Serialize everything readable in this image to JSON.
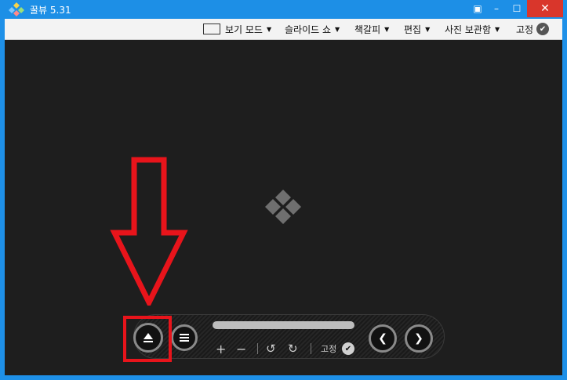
{
  "window": {
    "title": "꿀뷰 5.31",
    "close_glyph": "✕",
    "minimize_glyph": "–",
    "maximize_glyph": "☐",
    "fit_glyph": "▣"
  },
  "menubar": {
    "items": [
      {
        "label": "보기 모드",
        "icon": "view-mode-icon"
      },
      {
        "label": "슬라이드 쇼"
      },
      {
        "label": "책갈피"
      },
      {
        "label": "편집"
      },
      {
        "label": "사진 보관함"
      },
      {
        "label": "고정",
        "icon": "check-circle-icon"
      }
    ],
    "caret": "▼"
  },
  "controls": {
    "zoom_in": "+",
    "zoom_out": "−",
    "rotate_left": "↺",
    "rotate_right": "↻",
    "pin_label": "고정",
    "check": "✔",
    "prev": "❮",
    "next": "❯"
  },
  "colors": {
    "titlebar": "#1d8fe6",
    "close": "#d9362b",
    "viewport": "#1e1e1e",
    "highlight": "#e8141b"
  }
}
